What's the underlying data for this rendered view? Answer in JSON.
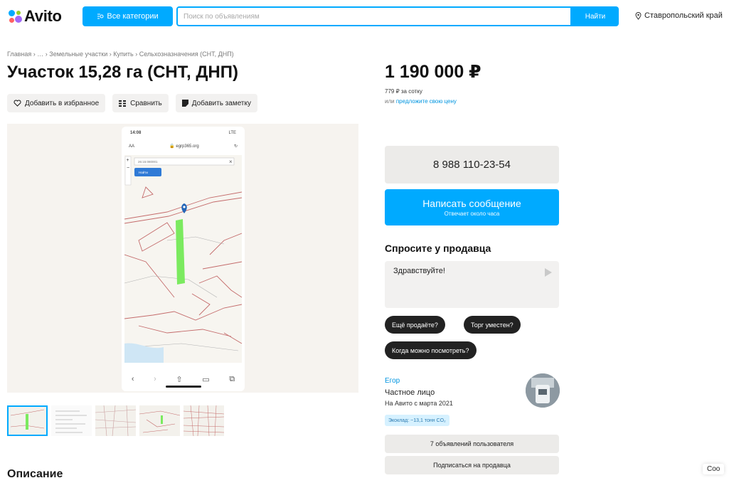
{
  "header": {
    "logo_text": "Avito",
    "categories_label": "Все категории",
    "search_placeholder": "Поиск по объявлениям",
    "search_button": "Найти",
    "region": "Ставропольский край"
  },
  "breadcrumb": "Главная › … › Земельные участки › Купить › Сельхозназначения (СНТ, ДНП)",
  "listing": {
    "title": "Участок 15,28 га (СНТ, ДНП)",
    "price": "1 190 000 ₽",
    "price_per_unit": "779 ₽ за сотку",
    "offer_prefix": "или ",
    "offer_link": "предложите свою цену"
  },
  "actions": {
    "favorite": "Добавить в избранное",
    "compare": "Сравнить",
    "note": "Добавить заметку"
  },
  "gallery": {
    "phone_time": "14:08",
    "phone_signal": "LTE",
    "phone_url": "egrp365.org",
    "phone_aa": "AA",
    "map_coords": "26:15:080001",
    "map_find": "Найти",
    "thumb_count": 5,
    "active_thumb": 1
  },
  "contact": {
    "phone": "8 988 110-23-54",
    "message_label": "Написать сообщение",
    "message_sub": "Отвечает около часа"
  },
  "ask": {
    "title": "Спросите у продавца",
    "message_value": "Здравствуйте!",
    "chips": [
      "Ещё продаёте?",
      "Торг уместен?",
      "Когда можно посмотреть?"
    ]
  },
  "seller": {
    "name": "Егор",
    "type": "Частное лицо",
    "since": "На Авито с марта 2021",
    "eco": "Экоклад: ~13,1 тонн CO₂",
    "listings_button": "7 объявлений пользователя",
    "subscribe_button": "Подписаться на продавца"
  },
  "description_title": "Описание",
  "corner_text": "Соо",
  "colors": {
    "accent": "#00aaff",
    "chip_bg": "#222222",
    "button_gray": "#ecebe9",
    "plot_green": "#7bea5f"
  }
}
